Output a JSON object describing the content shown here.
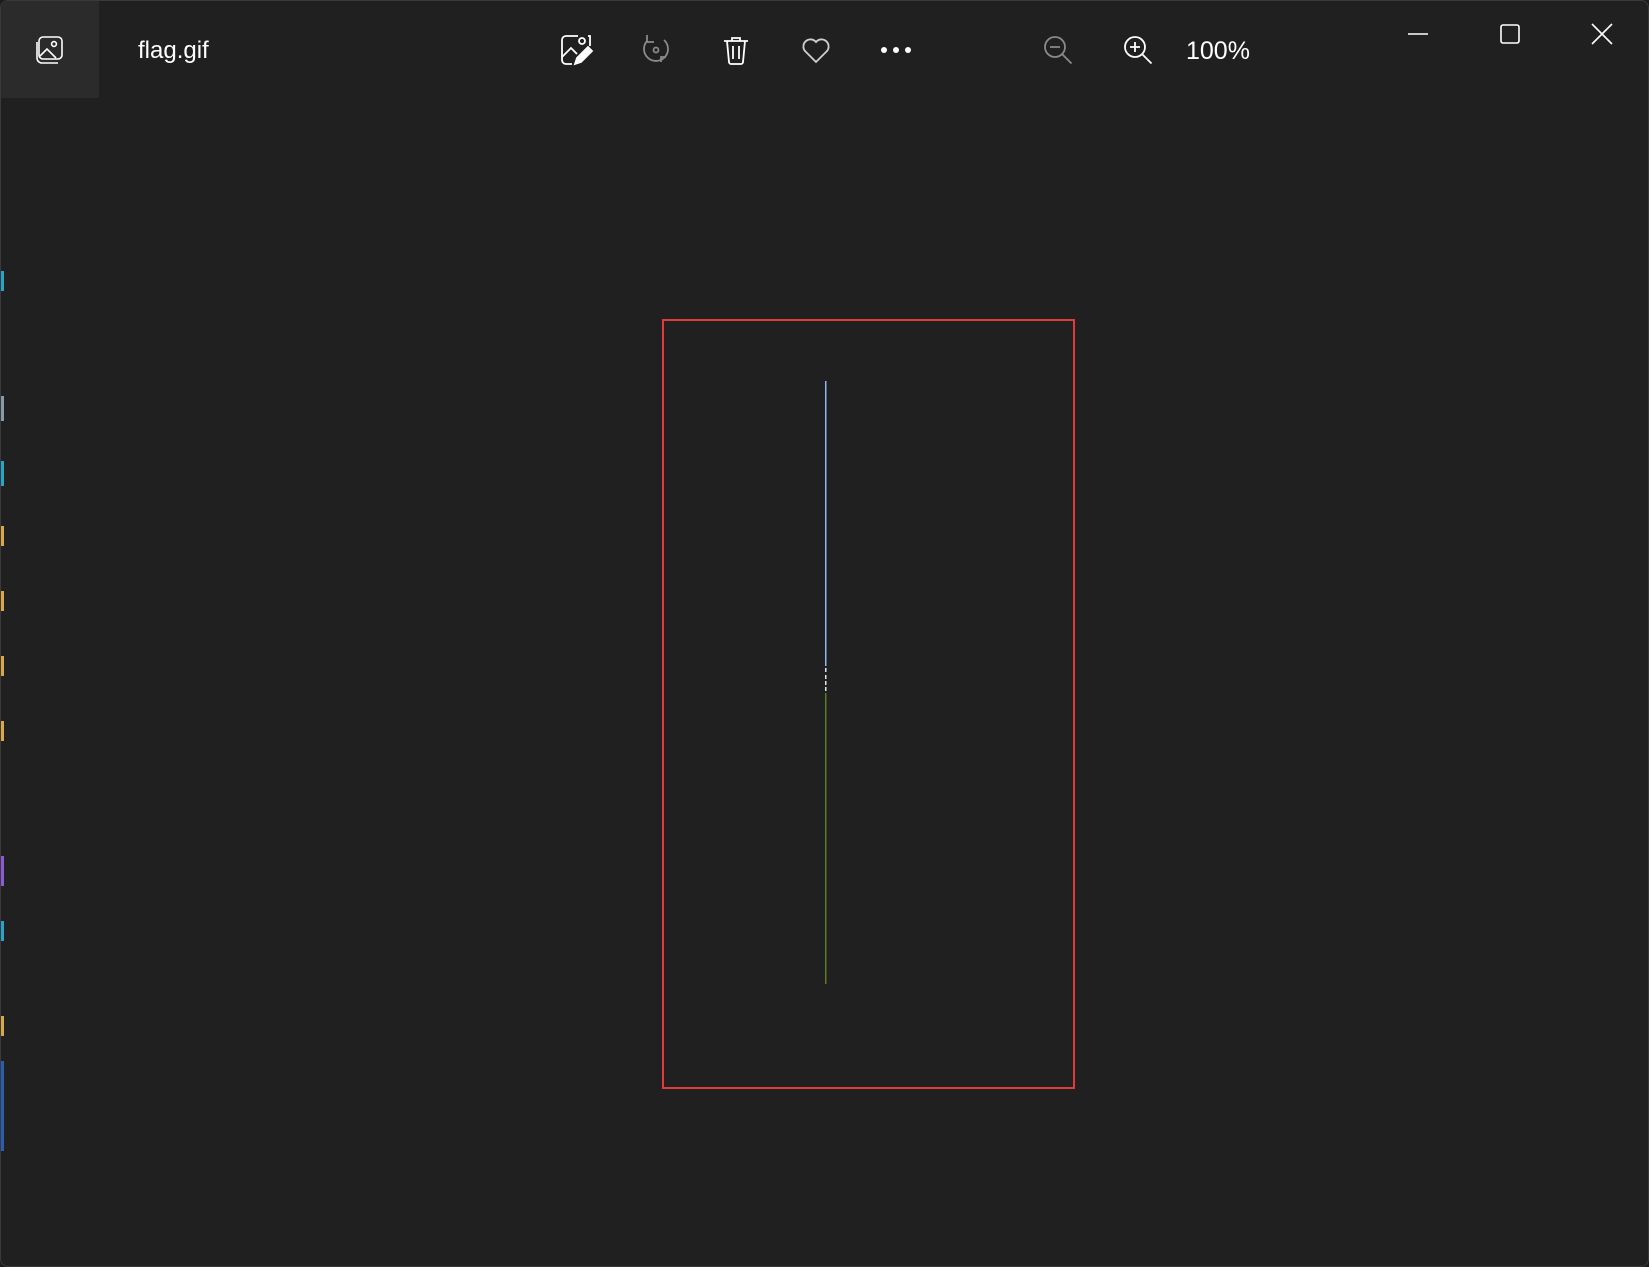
{
  "window": {
    "title": "flag.gif"
  },
  "toolbar": {
    "edit_icon": "image-edit-icon",
    "rotate_icon": "rotate-icon",
    "delete_icon": "trash-icon",
    "favorite_icon": "heart-icon",
    "more_icon": "more-ellipsis-icon",
    "zoom_out_icon": "zoom-out-icon",
    "zoom_in_icon": "zoom-in-icon",
    "zoom_level": "100%"
  },
  "window_controls": {
    "minimize_icon": "minimize-icon",
    "maximize_icon": "maximize-icon",
    "close_icon": "close-icon"
  },
  "colors": {
    "background": "#202020",
    "highlight_border": "#e03a3a",
    "image_top_line": "#8fb4f2",
    "image_bottom_line": "#5c7a1e"
  }
}
